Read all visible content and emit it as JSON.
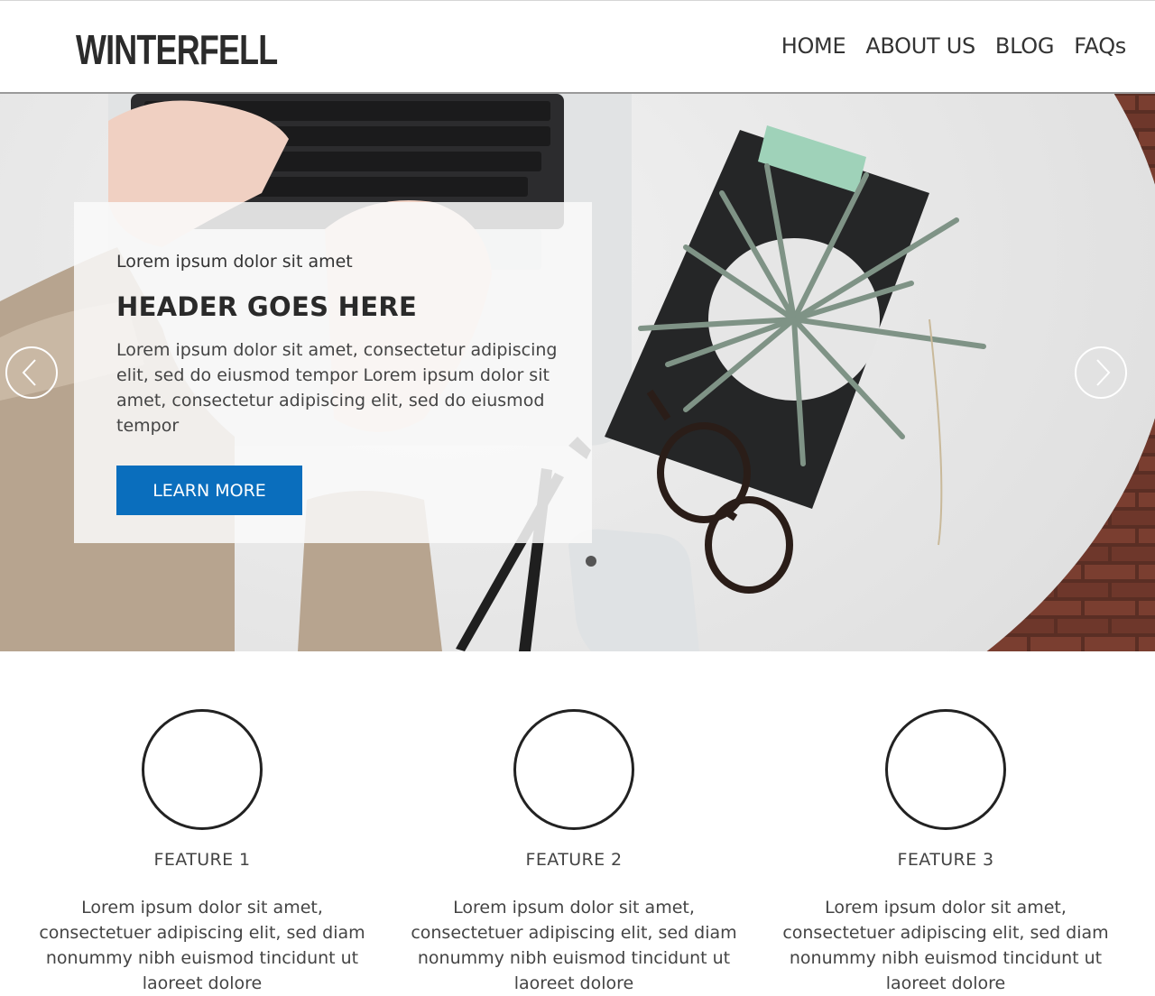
{
  "header": {
    "logo": "WINTERFELL",
    "nav": [
      {
        "label": "HOME"
      },
      {
        "label": "ABOUT US"
      },
      {
        "label": "BLOG"
      },
      {
        "label": "FAQs"
      }
    ]
  },
  "hero": {
    "kicker": "Lorem ipsum dolor sit amet",
    "title": "HEADER GOES HERE",
    "text": "Lorem ipsum dolor sit amet, consectetur adipiscing elit, sed do eiusmod tempor Lorem ipsum dolor sit amet, consectetur adipiscing elit, sed do eiusmod tempor",
    "button_label": "LEARN MORE",
    "button_color": "#0a6ebd",
    "prev_icon": "chevron-left-icon",
    "next_icon": "chevron-right-icon"
  },
  "features": [
    {
      "title": "FEATURE 1",
      "text": "Lorem ipsum dolor sit amet, consectetuer adipiscing elit, sed diam nonummy nibh euismod tincidunt ut laoreet dolore"
    },
    {
      "title": "FEATURE 2",
      "text": "Lorem ipsum dolor sit amet, consectetuer adipiscing elit, sed diam nonummy nibh euismod tincidunt ut laoreet dolore"
    },
    {
      "title": "FEATURE 3",
      "text": "Lorem ipsum dolor sit amet, consectetuer adipiscing elit, sed diam nonummy nibh euismod tincidunt ut laoreet dolore"
    }
  ]
}
